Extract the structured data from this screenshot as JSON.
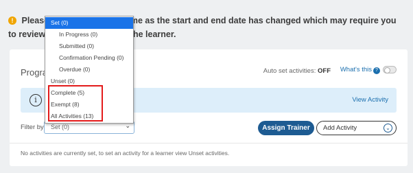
{
  "alert": {
    "text": "Please review the programme as the start and end date has changed which may require you to review the activity dates of the learner."
  },
  "section": {
    "title": "Programme Activities"
  },
  "autoset": {
    "label": "Auto set activities:",
    "state": "OFF",
    "whats_this": "What's this",
    "help_icon_glyph": "?"
  },
  "banner": {
    "info_icon_glyph": "i",
    "view_activity": "View Activity"
  },
  "filter": {
    "label": "Filter by",
    "selected": "Set (0)",
    "chevron_glyph": "⌄"
  },
  "buttons": {
    "assign_trainer": "Assign Trainer",
    "add_activity": "Add Activity",
    "add_activity_glyph": "⌄"
  },
  "note": "No activities are currently set, to set an activity for a learner view Unset activities.",
  "dropdown": {
    "options": [
      {
        "label": "Set (0)"
      },
      {
        "label": "In Progress (0)"
      },
      {
        "label": "Submitted (0)"
      },
      {
        "label": "Confirmation Pending (0)"
      },
      {
        "label": "Overdue (0)"
      },
      {
        "label": "Unset (0)"
      },
      {
        "label": "Complete (5)"
      },
      {
        "label": "Exempt (8)"
      },
      {
        "label": "All Activities (13)"
      }
    ]
  },
  "colors": {
    "accent": "#1d5b92",
    "selected_option": "#1a73e8",
    "highlight": "#e31a1a",
    "warning": "#f0a500",
    "banner": "#ddeefa"
  }
}
